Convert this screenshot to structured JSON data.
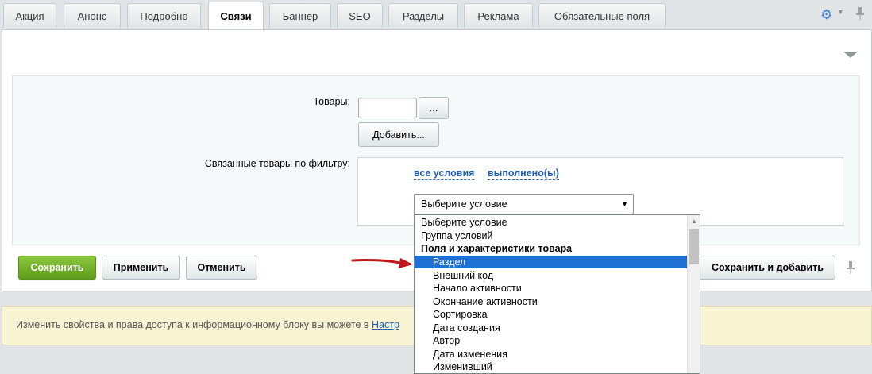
{
  "tabs": [
    {
      "label": "Акция"
    },
    {
      "label": "Анонс"
    },
    {
      "label": "Подробно"
    },
    {
      "label": "Связи"
    },
    {
      "label": "Баннер"
    },
    {
      "label": "SEO"
    },
    {
      "label": "Разделы"
    },
    {
      "label": "Реклама"
    },
    {
      "label": "Обязательные поля"
    }
  ],
  "active_tab": "Связи",
  "form": {
    "goods_label": "Товары:",
    "goods_value": "",
    "browse_button": "...",
    "add_button": "Добавить...",
    "filter_label": "Связанные товары по фильтру:",
    "all_conditions": "все условия",
    "fulfilled": "выполнено(ы)",
    "select_value": "Выберите условие"
  },
  "dropdown": {
    "options": [
      {
        "label": "Выберите условие",
        "bold": false,
        "indent": false,
        "selected": false
      },
      {
        "label": "Группа условий",
        "bold": false,
        "indent": false,
        "selected": false
      },
      {
        "label": "Поля и характеристики товара",
        "bold": true,
        "indent": false,
        "selected": false
      },
      {
        "label": "Раздел",
        "bold": false,
        "indent": true,
        "selected": true
      },
      {
        "label": "Внешний код",
        "bold": false,
        "indent": true,
        "selected": false
      },
      {
        "label": "Начало активности",
        "bold": false,
        "indent": true,
        "selected": false
      },
      {
        "label": "Окончание активности",
        "bold": false,
        "indent": true,
        "selected": false
      },
      {
        "label": "Сортировка",
        "bold": false,
        "indent": true,
        "selected": false
      },
      {
        "label": "Дата создания",
        "bold": false,
        "indent": true,
        "selected": false
      },
      {
        "label": "Автор",
        "bold": false,
        "indent": true,
        "selected": false
      },
      {
        "label": "Дата изменения",
        "bold": false,
        "indent": true,
        "selected": false
      },
      {
        "label": "Изменивший",
        "bold": false,
        "indent": true,
        "selected": false
      }
    ]
  },
  "buttons": {
    "save": "Сохранить",
    "apply": "Применить",
    "cancel": "Отменить",
    "save_and_add": "Сохранить и добавить"
  },
  "info": {
    "text": "Изменить свойства и права доступа к информационному блоку вы можете в ",
    "link": "Настр"
  },
  "colors": {
    "accent": "#1e5eb5",
    "save_green": "#6aa924",
    "selected_option": "#1e70d5",
    "annotation_arrow": "#c0161c"
  },
  "icons": [
    "gear-icon",
    "chevron-down-icon",
    "pin-icon",
    "collapse-icon",
    "arrow-annotation"
  ]
}
